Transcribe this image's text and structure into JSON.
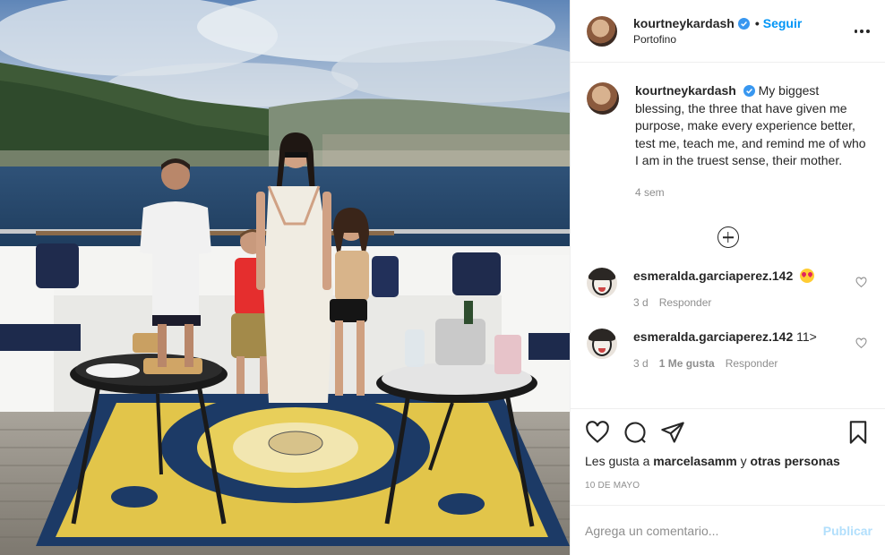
{
  "post": {
    "username": "kourtneykardash",
    "follow_label": "Seguir",
    "dot": "•",
    "location": "Portofino",
    "caption_text": "My biggest blessing, the three that have given me purpose, make every experience better, test me, teach me, and remind me of who I am in the truest sense, their mother.",
    "caption_time": "4 sem"
  },
  "comments": [
    {
      "username": "esmeralda.garciaperez.142",
      "text": "",
      "emoji": "heart-eyes-emoji",
      "time": "3 d",
      "likes_label": "",
      "reply_label": "Responder"
    },
    {
      "username": "esmeralda.garciaperez.142",
      "text": "11>",
      "time": "3 d",
      "likes_label": "1 Me gusta",
      "reply_label": "Responder"
    }
  ],
  "likes": {
    "prefix": "Les gusta a",
    "user": "marcelasamm",
    "middle": "y",
    "rest": "otras personas"
  },
  "date": "10 DE MAYO",
  "add_comment": {
    "placeholder": "Agrega un comentario...",
    "publish_label": "Publicar"
  },
  "colors": {
    "accent": "#0095f6",
    "publish_disabled": "#b2dffc",
    "muted": "#8e8e8e",
    "verified": "#3897f0"
  },
  "icons": [
    "verified-badge-icon",
    "more-options-icon",
    "load-more-icon",
    "heart-icon",
    "comment-icon",
    "share-icon",
    "bookmark-icon"
  ]
}
